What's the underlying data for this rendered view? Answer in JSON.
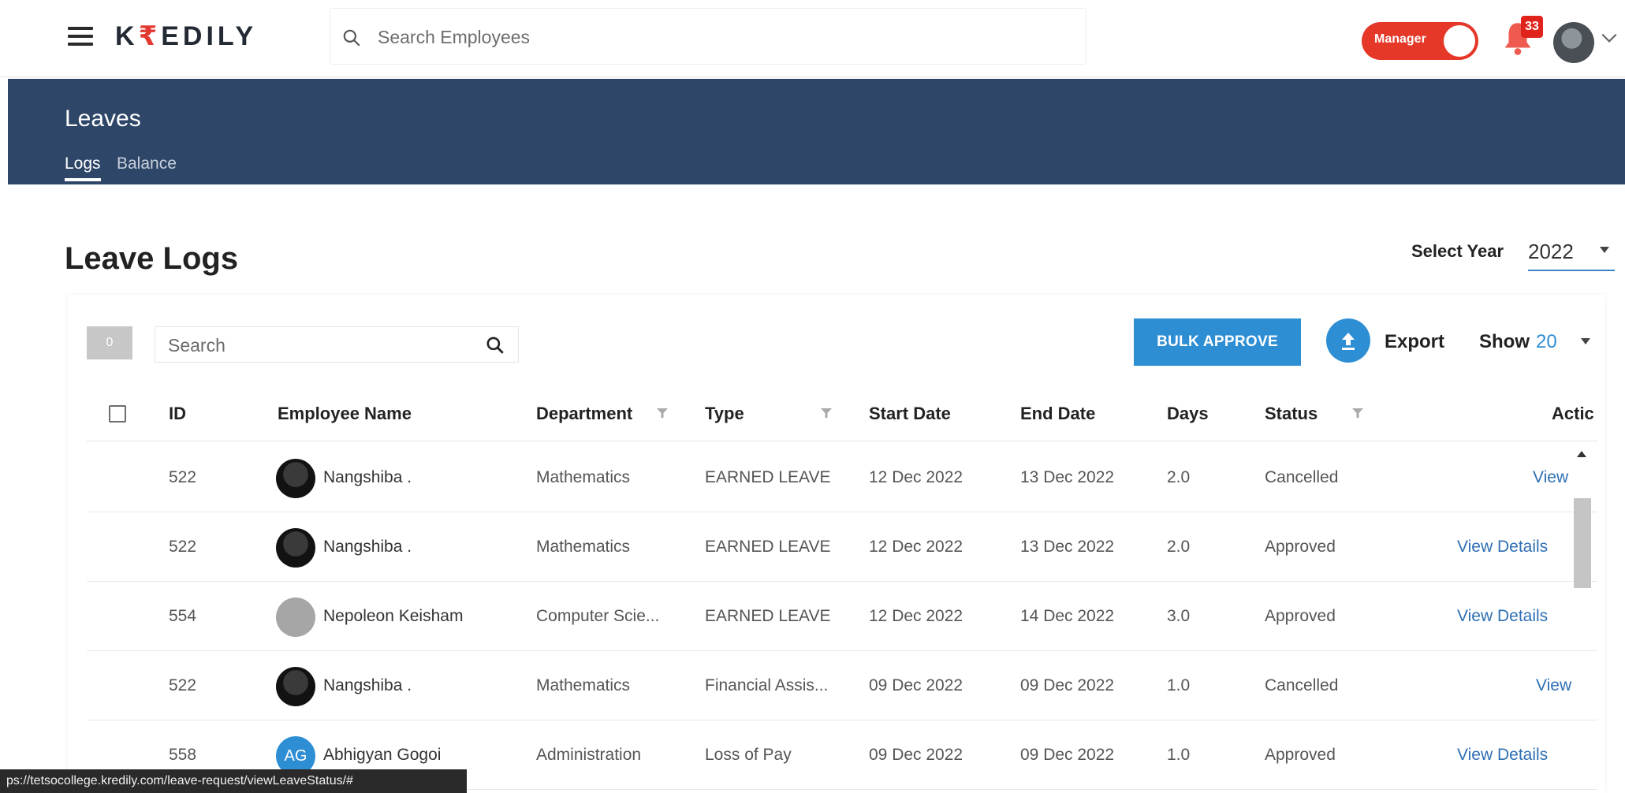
{
  "header": {
    "logo_pre": "K",
    "logo_accent": "₹",
    "logo_post": "EDILY",
    "search_placeholder": "Search Employees",
    "role_toggle_label": "Manager",
    "notification_count": "33"
  },
  "banner": {
    "title": "Leaves",
    "tabs": [
      {
        "label": "Logs",
        "active": true
      },
      {
        "label": "Balance",
        "active": false
      }
    ]
  },
  "page": {
    "title": "Leave Logs",
    "select_year_label": "Select Year",
    "select_year_value": "2022"
  },
  "toolbar": {
    "selected_count": "0",
    "search_placeholder": "Search",
    "bulk_approve_label": "BULK APPROVE",
    "export_label": "Export",
    "show_label": "Show",
    "show_value": "20"
  },
  "table": {
    "columns": [
      "ID",
      "Employee Name",
      "Department",
      "Type",
      "Start Date",
      "End Date",
      "Days",
      "Status",
      "Actic"
    ],
    "rows": [
      {
        "id": "522",
        "name": "Nangshiba .",
        "avatar": "dark",
        "initials": "",
        "department": "Mathematics",
        "type": "EARNED LEAVE",
        "start": "12 Dec 2022",
        "end": "13 Dec 2022",
        "days": "2.0",
        "status": "Cancelled",
        "action": "View"
      },
      {
        "id": "522",
        "name": "Nangshiba .",
        "avatar": "dark",
        "initials": "",
        "department": "Mathematics",
        "type": "EARNED LEAVE",
        "start": "12 Dec 2022",
        "end": "13 Dec 2022",
        "days": "2.0",
        "status": "Approved",
        "action": "View Details"
      },
      {
        "id": "554",
        "name": "Nepoleon Keisham",
        "avatar": "gray",
        "initials": "",
        "department": "Computer Scie...",
        "type": "EARNED LEAVE",
        "start": "12 Dec 2022",
        "end": "14 Dec 2022",
        "days": "3.0",
        "status": "Approved",
        "action": "View Details"
      },
      {
        "id": "522",
        "name": "Nangshiba .",
        "avatar": "dark",
        "initials": "",
        "department": "Mathematics",
        "type": "Financial Assis...",
        "start": "09 Dec 2022",
        "end": "09 Dec 2022",
        "days": "1.0",
        "status": "Cancelled",
        "action": "View"
      },
      {
        "id": "558",
        "name": "Abhigyan Gogoi",
        "avatar": "initials",
        "initials": "AG",
        "department": "Administration",
        "type": "Loss of Pay",
        "start": "09 Dec 2022",
        "end": "09 Dec 2022",
        "days": "1.0",
        "status": "Approved",
        "action": "View Details"
      }
    ]
  },
  "status_bar": {
    "url": "ps://tetsocollege.kredily.com/leave-request/viewLeaveStatus/#"
  },
  "colors": {
    "brand_dark": "#232a33",
    "brand_accent": "#e2382f",
    "banner": "#2e4668",
    "primary": "#2e8ed4",
    "link": "#2e6fb3",
    "toggle": "#e53828"
  }
}
